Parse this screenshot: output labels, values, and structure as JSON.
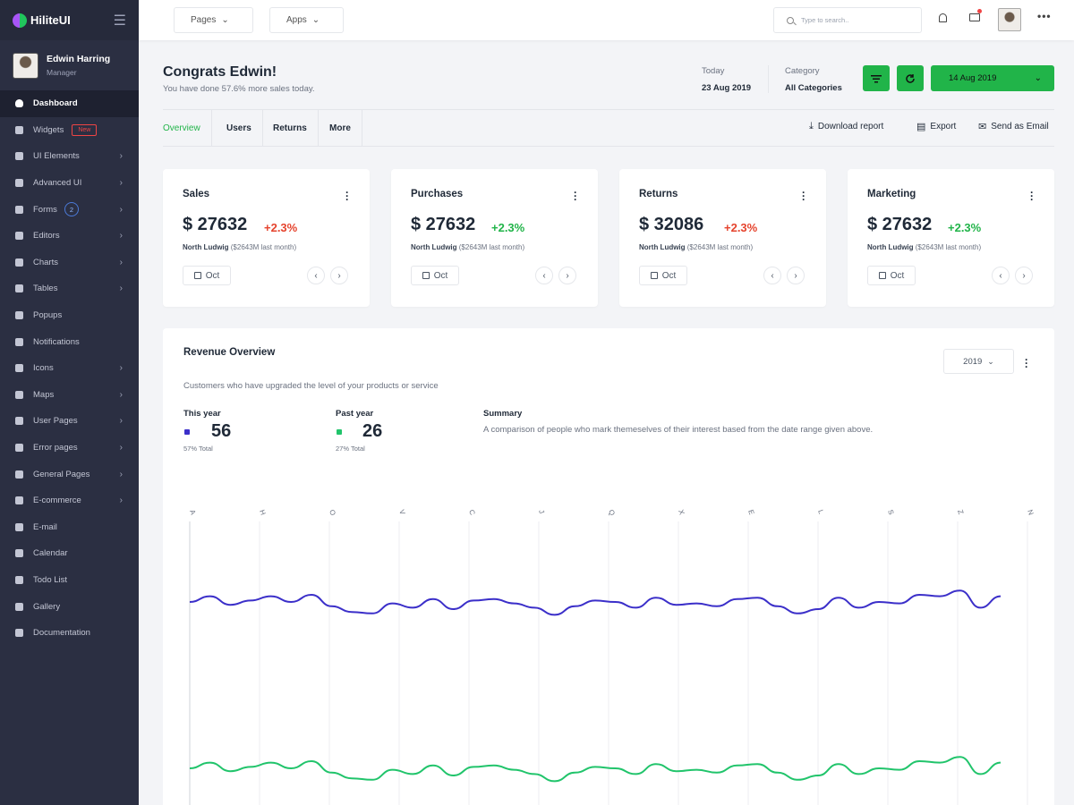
{
  "brand": {
    "name": "HiliteUI"
  },
  "sidebar": {
    "profile": {
      "name": "Edwin Harring",
      "role": "Manager"
    },
    "items": [
      {
        "label": "Dashboard",
        "icon": "shield-check-icon",
        "active": true,
        "chevron": false
      },
      {
        "label": "Widgets",
        "icon": "puzzle-icon",
        "badge": "New",
        "chevron": false
      },
      {
        "label": "UI Elements",
        "icon": "layout-icon",
        "chevron": true
      },
      {
        "label": "Advanced UI",
        "icon": "palette-icon",
        "chevron": true
      },
      {
        "label": "Forms",
        "icon": "list-icon",
        "count": "2",
        "chevron": true
      },
      {
        "label": "Editors",
        "icon": "pencil-icon",
        "chevron": true
      },
      {
        "label": "Charts",
        "icon": "bar-chart-icon",
        "chevron": true
      },
      {
        "label": "Tables",
        "icon": "table-icon",
        "chevron": true
      },
      {
        "label": "Popups",
        "icon": "popup-icon",
        "chevron": false
      },
      {
        "label": "Notifications",
        "icon": "bell-icon",
        "chevron": false
      },
      {
        "label": "Icons",
        "icon": "smile-icon",
        "chevron": true
      },
      {
        "label": "Maps",
        "icon": "map-icon",
        "chevron": true
      },
      {
        "label": "User Pages",
        "icon": "user-icon",
        "chevron": true
      },
      {
        "label": "Error pages",
        "icon": "alert-icon",
        "chevron": true
      },
      {
        "label": "General Pages",
        "icon": "grid-icon",
        "chevron": true
      },
      {
        "label": "E-commerce",
        "icon": "cart-icon",
        "chevron": true
      },
      {
        "label": "E-mail",
        "icon": "mail-icon",
        "chevron": false
      },
      {
        "label": "Calendar",
        "icon": "calendar-icon",
        "chevron": false
      },
      {
        "label": "Todo List",
        "icon": "checkbox-icon",
        "chevron": false
      },
      {
        "label": "Gallery",
        "icon": "gallery-icon",
        "chevron": false
      },
      {
        "label": "Documentation",
        "icon": "document-icon",
        "chevron": false
      }
    ]
  },
  "topbar": {
    "pages_label": "Pages",
    "apps_label": "Apps",
    "search_placeholder": "Type to search..",
    "more_label": "•••"
  },
  "header": {
    "title": "Congrats Edwin!",
    "subtitle": "You have done 57.6% more sales today.",
    "today_label": "Today",
    "today_value": "23 Aug 2019",
    "category_label": "Category",
    "category_value": "All Categories",
    "date_button": "14 Aug 2019"
  },
  "tabs": [
    "Overview",
    "Users",
    "Returns",
    "More"
  ],
  "actions": {
    "download": "Download report",
    "export": "Export",
    "email": "Send as Email"
  },
  "cards": [
    {
      "title": "Sales",
      "amount": "$ 27632",
      "change": "+2.3%",
      "change_color": "#e5432d",
      "sub_bold": "North Ludwig",
      "sub": " ($2643M last month)",
      "month": "Oct"
    },
    {
      "title": "Purchases",
      "amount": "$ 27632",
      "change": "+2.3%",
      "change_color": "#21b449",
      "sub_bold": "North Ludwig",
      "sub": " ($2643M last month)",
      "month": "Oct"
    },
    {
      "title": "Returns",
      "amount": "$ 32086",
      "change": "+2.3%",
      "change_color": "#e5432d",
      "sub_bold": "North Ludwig",
      "sub": " ($2643M last month)",
      "month": "Oct"
    },
    {
      "title": "Marketing",
      "amount": "$ 27632",
      "change": "+2.3%",
      "change_color": "#21b449",
      "sub_bold": "North Ludwig",
      "sub": " ($2643M last month)",
      "month": "Oct"
    }
  ],
  "revenue": {
    "title": "Revenue Overview",
    "subtitle": "Customers who have upgraded the level of your products or service",
    "year": "2019",
    "this_year": {
      "label": "This year",
      "value": "56",
      "total": "57% Total",
      "color": "#3b2fc9"
    },
    "past_year": {
      "label": "Past year",
      "value": "26",
      "total": "27% Total",
      "color": "#21c46b"
    },
    "summary_title": "Summary",
    "summary_text": "A comparison of people who mark themeselves of their interest based from the date range given above."
  },
  "chart_data": {
    "type": "line",
    "x": [
      "A",
      "H",
      "O",
      "V",
      "C",
      "J",
      "Q",
      "X",
      "E",
      "L",
      "S",
      "Z",
      "N"
    ],
    "series": [
      {
        "color": "#3b2fc9",
        "values": [
          56,
          60,
          54,
          57,
          60,
          56,
          61,
          53,
          49,
          48,
          55,
          52,
          58,
          51,
          57,
          58,
          55,
          52,
          47,
          53,
          57,
          56,
          52,
          59,
          54,
          55,
          53,
          58,
          59,
          53,
          48,
          51,
          59,
          52,
          56,
          55,
          61,
          60,
          64,
          52,
          60
        ]
      },
      {
        "color": "#21c46b",
        "values": [
          56,
          60,
          54,
          57,
          60,
          56,
          61,
          53,
          49,
          48,
          55,
          52,
          58,
          51,
          57,
          58,
          55,
          52,
          47,
          53,
          57,
          56,
          52,
          59,
          54,
          55,
          53,
          58,
          59,
          53,
          48,
          51,
          59,
          52,
          56,
          55,
          61,
          60,
          64,
          52,
          60
        ]
      }
    ]
  }
}
